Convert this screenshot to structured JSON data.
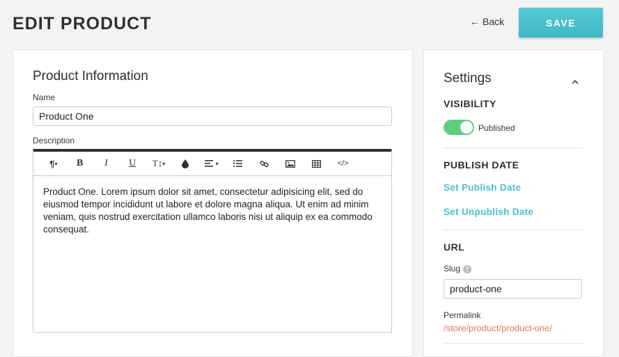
{
  "header": {
    "title": "EDIT PRODUCT",
    "back_label": "Back",
    "back_arrow": "←",
    "save_label": "SAVE"
  },
  "product_info": {
    "title": "Product Information",
    "name_label": "Name",
    "name_value": "Product One",
    "description_label": "Description",
    "toolbar": {
      "paragraph": "¶",
      "bold": "B",
      "italic": "I",
      "underline": "U",
      "font_size": "T↕",
      "color": "●",
      "align": "≡",
      "list": "☰",
      "link": "🔗",
      "image": "▣",
      "table": "▦",
      "code": "</>"
    },
    "description_text": "Product One. Lorem ipsum dolor sit amet, consectetur adipisicing elit, sed do eiusmod tempor incididunt ut labore et dolore magna aliqua. Ut enim ad minim veniam, quis nostrud exercitation ullamco laboris nisi ut aliquip ex ea commodo consequat."
  },
  "settings": {
    "title": "Settings",
    "collapse_chevron": "^",
    "visibility_heading": "VISIBILITY",
    "visibility_state": "Published",
    "publish_date_heading": "PUBLISH DATE",
    "set_publish_date": "Set Publish Date",
    "set_unpublish_date": "Set Unpublish Date",
    "url_heading": "URL",
    "slug_label": "Slug",
    "slug_help": "?",
    "slug_value": "product-one",
    "permalink_label": "Permalink",
    "permalink_value": "/store/product/product-one/"
  },
  "colors": {
    "accent": "#4cbfcb",
    "toggle_on": "#5ccf7f",
    "permalink": "#e07a55"
  }
}
